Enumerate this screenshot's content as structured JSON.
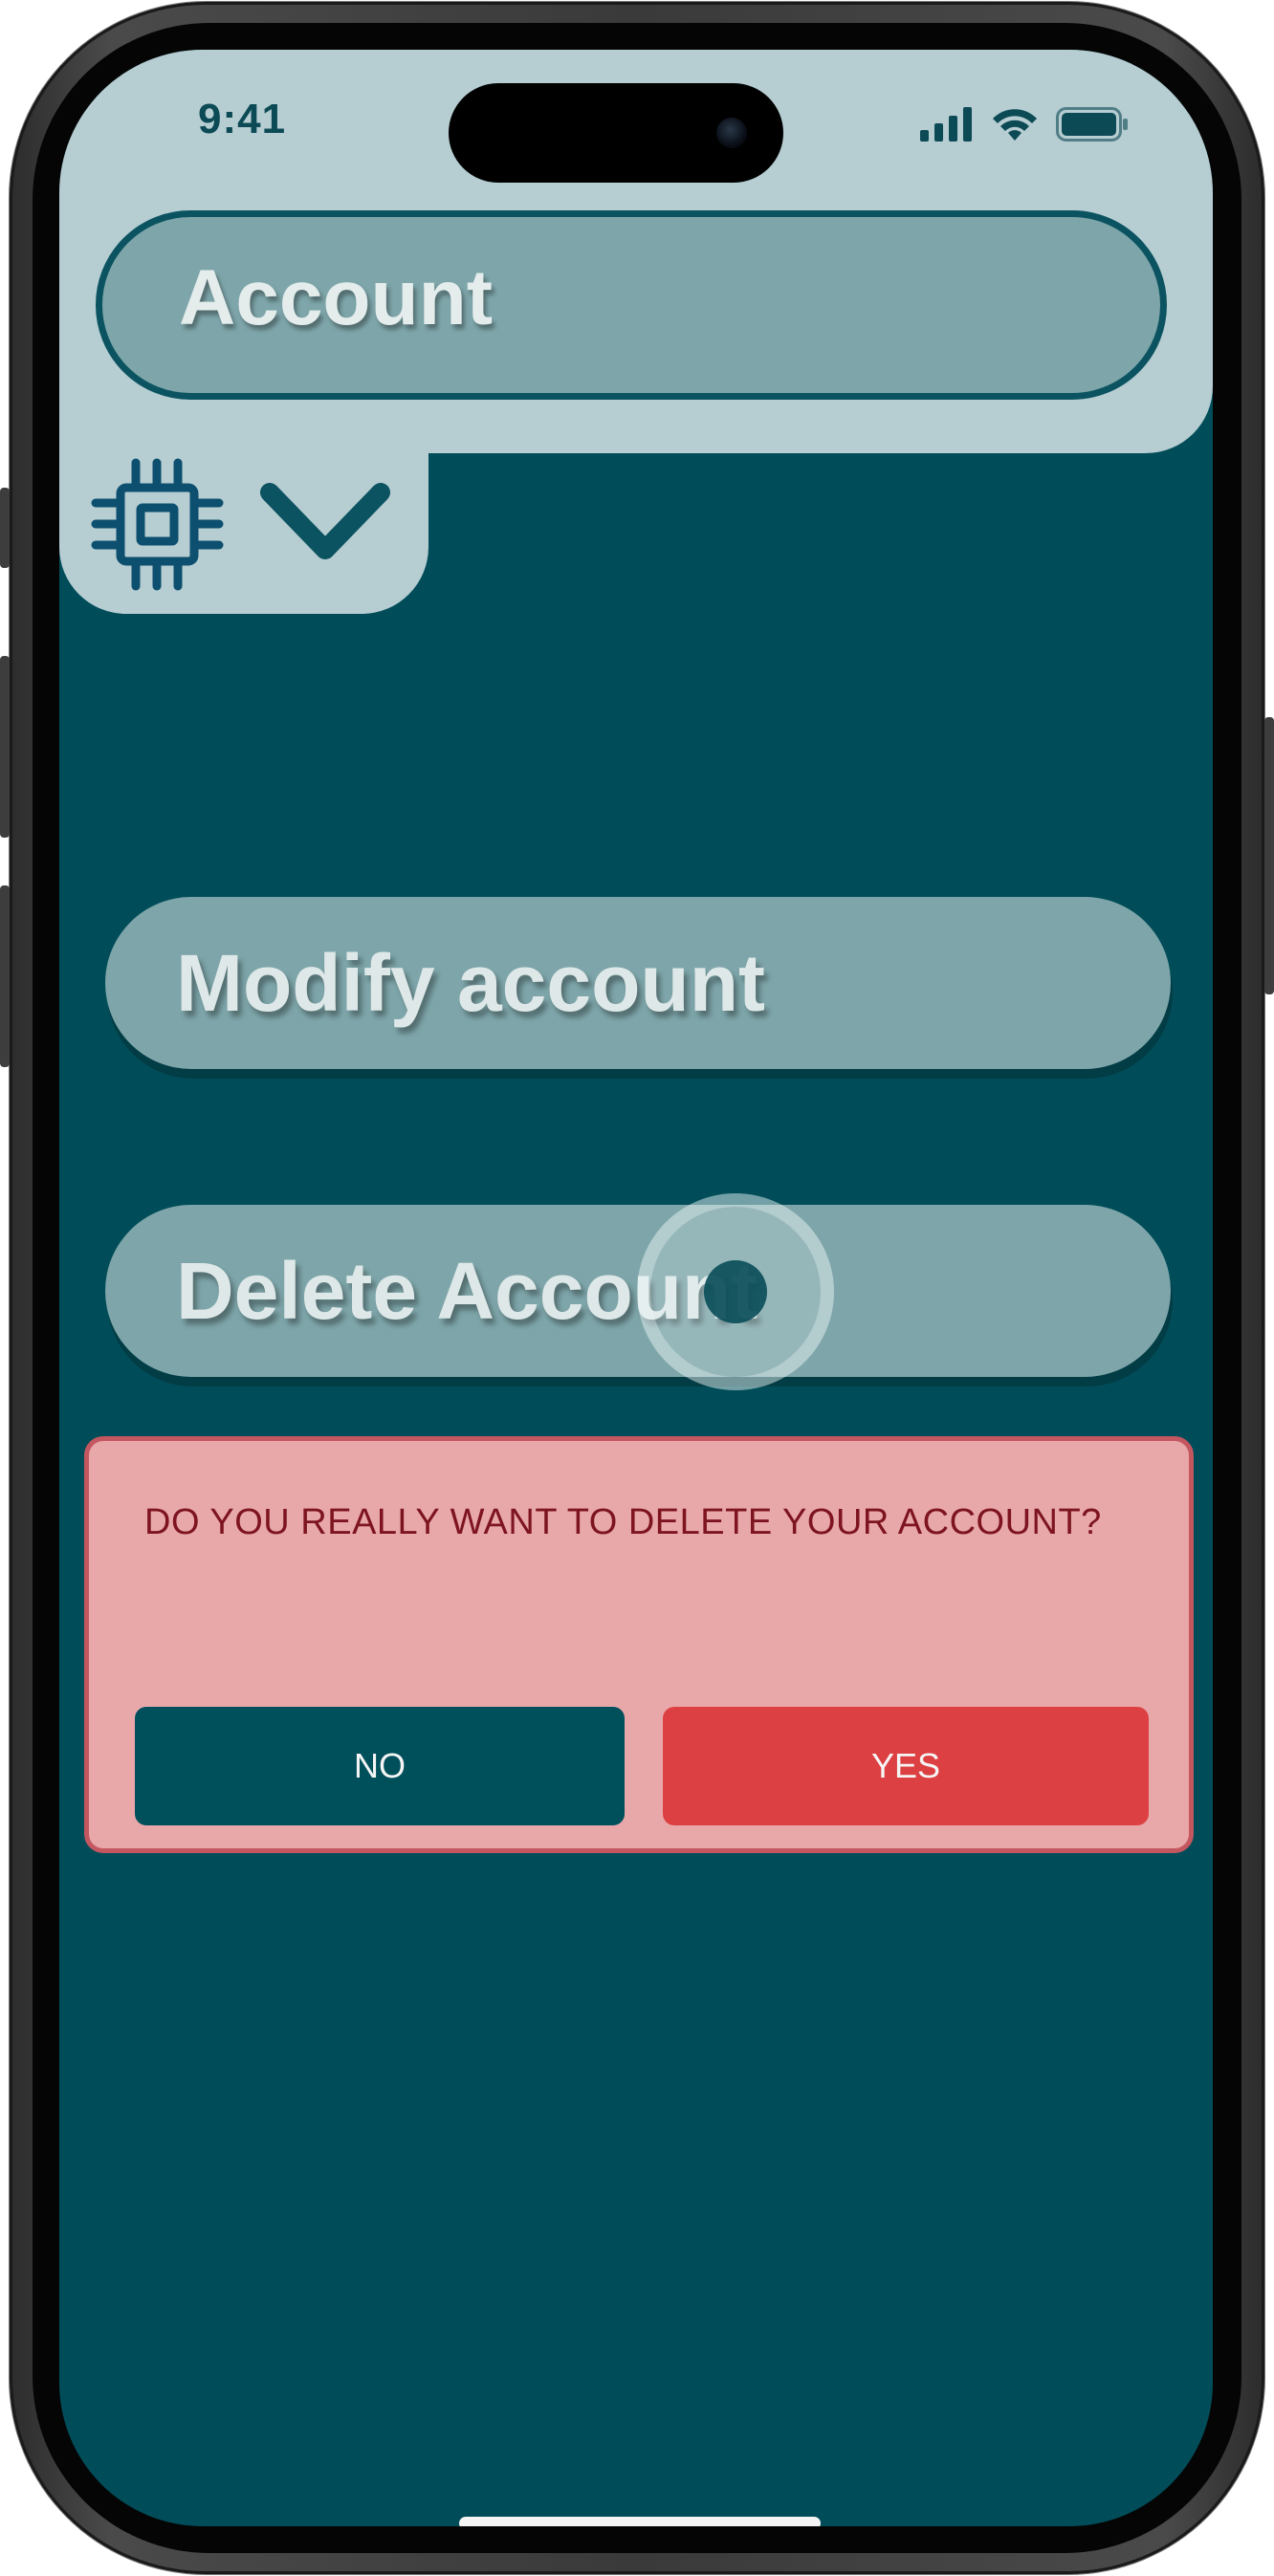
{
  "status_bar": {
    "time": "9:41"
  },
  "header": {
    "title": "Account"
  },
  "menu": {
    "modify_label": "Modify account",
    "delete_label": "Delete Account"
  },
  "dialog": {
    "message": "DO YOU REALLY WANT TO DELETE YOUR ACCOUNT?",
    "no_label": "NO",
    "yes_label": "YES"
  },
  "colors": {
    "background": "#004d59",
    "header_panel": "#b6cdd2",
    "button": "#7ea6aa",
    "dialog_bg": "#e8a8aa",
    "yes_button": "#dd4042",
    "no_button": "#00505c"
  },
  "icons": [
    "cpu-chip-icon",
    "chevron-down-icon",
    "signal-icon",
    "wifi-icon",
    "battery-icon"
  ]
}
